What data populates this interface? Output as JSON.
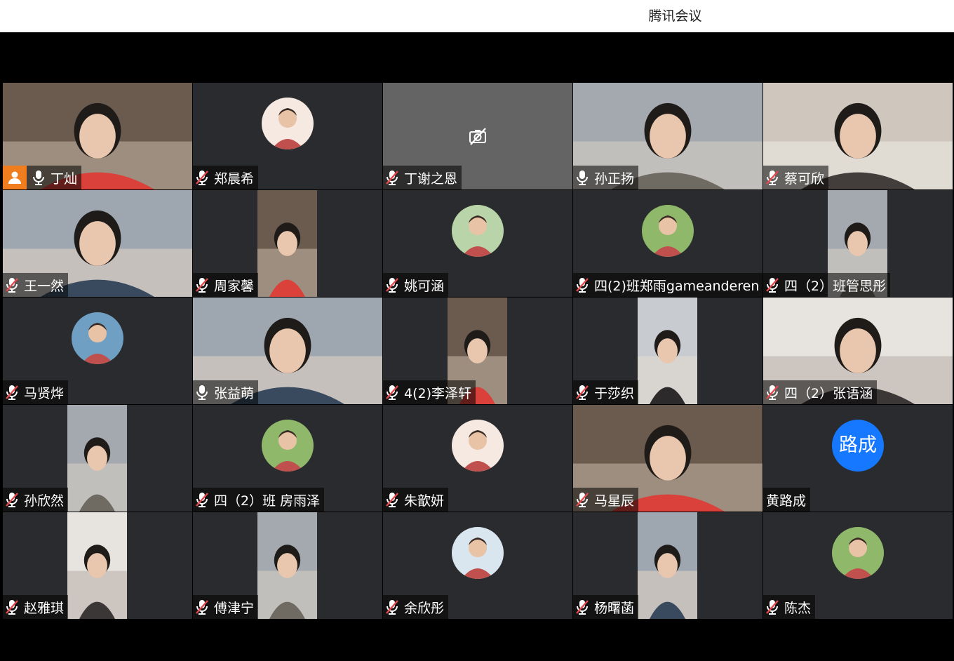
{
  "window": {
    "title": "腾讯会议"
  },
  "icons": {
    "mic_muted": "mic-muted-icon",
    "mic_on": "mic-icon",
    "host": "host-icon",
    "camera_off": "camera-off-icon"
  },
  "colors": {
    "tile_bg": "#2a2b2e",
    "host_badge": "#f07d1e",
    "active_speaker_border": "#3ac16b",
    "text_avatar_bg": "#1677ff"
  },
  "participants": [
    {
      "name": "丁灿",
      "mic": "on",
      "host": true,
      "view": "video"
    },
    {
      "name": "郑晨希",
      "mic": "muted",
      "view": "avatar"
    },
    {
      "name": "丁谢之恩",
      "mic": "muted",
      "view": "camera-off"
    },
    {
      "name": "孙正扬",
      "mic": "on",
      "view": "video"
    },
    {
      "name": "蔡可欣",
      "mic": "muted",
      "view": "video"
    },
    {
      "name": "王一然",
      "mic": "muted",
      "view": "video"
    },
    {
      "name": "周家馨",
      "mic": "muted",
      "view": "portrait"
    },
    {
      "name": "姚可涵",
      "mic": "muted",
      "view": "avatar"
    },
    {
      "name": "四(2)班郑雨gameanderen",
      "mic": "muted",
      "view": "avatar"
    },
    {
      "name": "四（2）班管思彤",
      "mic": "muted",
      "view": "portrait"
    },
    {
      "name": "马贤烨",
      "mic": "muted",
      "view": "avatar"
    },
    {
      "name": "张益萌",
      "mic": "on",
      "view": "video",
      "active": true
    },
    {
      "name": "4(2)李泽轩",
      "mic": "muted",
      "view": "portrait"
    },
    {
      "name": "于莎织",
      "mic": "muted",
      "view": "portrait"
    },
    {
      "name": "四（2）张语涵",
      "mic": "muted",
      "view": "video"
    },
    {
      "name": "孙欣然",
      "mic": "muted",
      "view": "portrait"
    },
    {
      "name": "四（2）班 房雨泽",
      "mic": "muted",
      "view": "avatar"
    },
    {
      "name": "朱歆妍",
      "mic": "muted",
      "view": "avatar"
    },
    {
      "name": "马星辰",
      "mic": "muted",
      "view": "video"
    },
    {
      "name": "黄路成",
      "mic": "none",
      "view": "text-avatar",
      "avatar_text": "路成"
    },
    {
      "name": "赵雅琪",
      "mic": "muted",
      "view": "portrait"
    },
    {
      "name": "傅津宁",
      "mic": "muted",
      "view": "portrait"
    },
    {
      "name": "余欣彤",
      "mic": "muted",
      "view": "avatar"
    },
    {
      "name": "杨曙菡",
      "mic": "muted",
      "view": "portrait"
    },
    {
      "name": "陈杰",
      "mic": "muted",
      "view": "avatar"
    }
  ]
}
